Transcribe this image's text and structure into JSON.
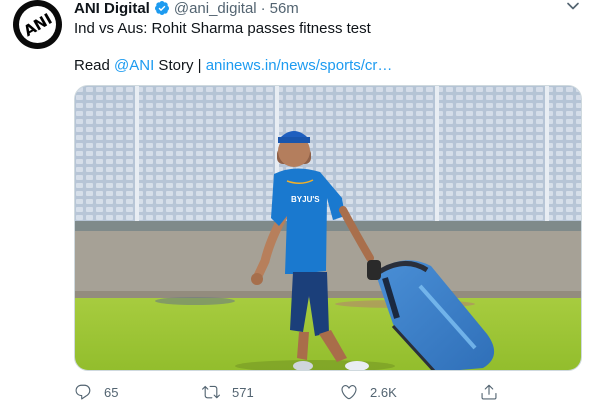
{
  "tweet": {
    "author_name": "ANI Digital",
    "handle": "@ani_digital",
    "separator": "·",
    "time": "56m",
    "line1": "Ind vs Aus: Rohit Sharma passes fitness test",
    "line2_prefix": "Read ",
    "line2_mention": "@ANI",
    "line2_middle": " Story | ",
    "line2_link": "aninews.in/news/sports/cr…",
    "avatar_text": "ANI",
    "jersey_text": "BYJU'S"
  },
  "actions": {
    "reply_count": "65",
    "retweet_count": "571",
    "like_count": "2.6K"
  },
  "colors": {
    "link": "#1d9bf0",
    "muted": "#536471",
    "verified": "#1d9bf0"
  },
  "icons": [
    "verified-badge-icon",
    "more-icon",
    "reply-icon",
    "retweet-icon",
    "like-icon",
    "share-icon"
  ]
}
